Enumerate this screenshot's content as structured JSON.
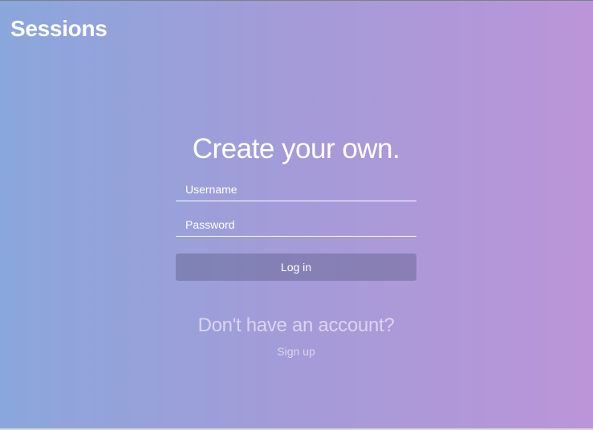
{
  "header": {
    "brand": "Sessions"
  },
  "login": {
    "headline": "Create your own.",
    "username_placeholder": "Username",
    "username_value": "",
    "password_placeholder": "Password",
    "password_value": "",
    "submit_label": "Log in"
  },
  "signup": {
    "prompt": "Don't have an account?",
    "link_label": "Sign up"
  },
  "colors": {
    "gradient_left": "#8aa7dc",
    "gradient_right": "#bb95d8",
    "text": "#ffffff"
  }
}
